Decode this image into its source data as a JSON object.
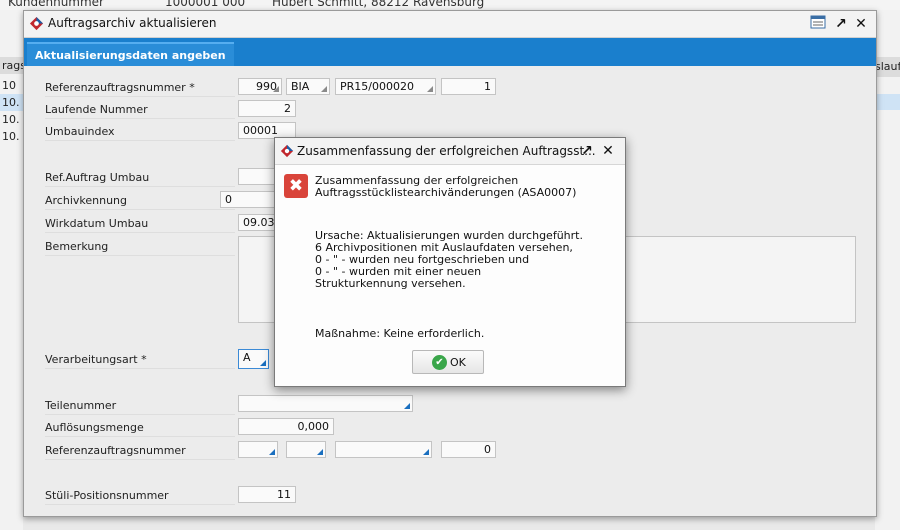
{
  "background": {
    "top_text_left": "Kundennummer",
    "top_text_mid": "1000001 000",
    "top_text_right": "Hubert Schmitt, 88212 Ravensburg",
    "left_header": "rags",
    "left_rows": [
      "10",
      "10.",
      "10.",
      "10."
    ],
    "right_header": "slauf"
  },
  "dialog": {
    "title": "Auftragsarchiv aktualisieren",
    "tab": "Aktualisierungsdaten angeben",
    "fields": {
      "referenzauftragsnummer_label": "Referenzauftragsnummer *",
      "ref_1": "990",
      "ref_2": "BIA",
      "ref_3": "PR15/000020",
      "ref_4": "1",
      "laufende_nummer_label": "Laufende Nummer",
      "laufende_nummer": "2",
      "umbauindex_label": "Umbauindex",
      "umbauindex": "00001",
      "ref_auftrag_umbau_label": "Ref.Auftrag Umbau",
      "ref_auftrag_umbau": "",
      "archivkennung_label": "Archivkennung",
      "archivkennung": "0",
      "wirkdatum_umbau_label": "Wirkdatum Umbau",
      "wirkdatum_umbau": "09.03.",
      "bemerkung_label": "Bemerkung",
      "verarbeitungsart_label": "Verarbeitungsart *",
      "verarbeitungsart": "A",
      "teilenummer_label": "Teilenummer",
      "teilenummer": "",
      "aufloesungsmenge_label": "Auflösungsmenge",
      "aufloesungsmenge": "0,000",
      "referenzauftragsnummer2_label": "Referenzauftragsnummer",
      "ref2_4": "0",
      "stueli_label": "Stüli-Positionsnummer",
      "stueli": "11"
    }
  },
  "info_dialog": {
    "title": "Zusammenfassung der erfolgreichen Auftragsst...",
    "header_line1": "Zusammenfassung der erfolgreichen",
    "header_line2": "Auftragsstücklistearchivänderungen (ASA0007)",
    "cause_lines": [
      "Ursache: Aktualisierungen wurden durchgeführt.",
      "6 Archivpositionen mit Auslaufdaten versehen,",
      "0 - \" - wurden neu fortgeschrieben und",
      "0 - \" - wurden mit einer neuen",
      "Strukturkennung versehen."
    ],
    "measure": "Maßnahme: Keine erforderlich.",
    "ok_label": "OK"
  },
  "colors": {
    "accent": "#1a7fcd",
    "error": "#d9443a",
    "ok": "#3aa64a"
  }
}
